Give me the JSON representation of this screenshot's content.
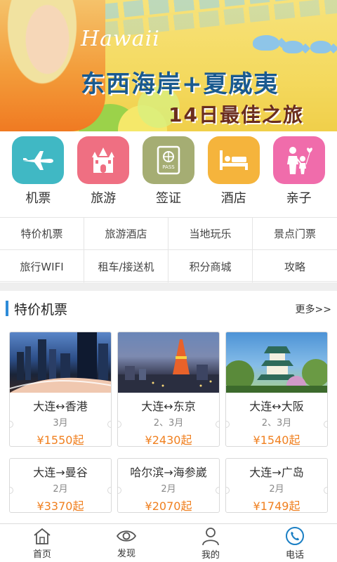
{
  "banner": {
    "script_text": "Hawaii",
    "headline": "东西海岸+夏威夷",
    "subline": "14日最佳之旅",
    "colors": {
      "bg": "#f4d95e",
      "headline": "#1a5a8f",
      "subline": "#6a2d1e"
    }
  },
  "categories": [
    {
      "label": "机票",
      "icon": "airplane-icon",
      "color": "#40b8c4"
    },
    {
      "label": "旅游",
      "icon": "castle-icon",
      "color": "#ef6f82"
    },
    {
      "label": "签证",
      "icon": "passport-icon",
      "color": "#a5ad73"
    },
    {
      "label": "酒店",
      "icon": "bed-icon",
      "color": "#f5b43c"
    },
    {
      "label": "亲子",
      "icon": "parent-child-icon",
      "color": "#f06cab"
    }
  ],
  "quick_links": [
    "特价机票",
    "旅游酒店",
    "当地玩乐",
    "景点门票",
    "旅行WIFI",
    "租车/接送机",
    "积分商城",
    "攻略"
  ],
  "section": {
    "title": "特价机票",
    "more": "更多>>",
    "accent": "#2d8bd8"
  },
  "flights": [
    {
      "route": "大连↔香港",
      "month": "3月",
      "price": "¥1550起",
      "price_value": "1550",
      "currency": "¥",
      "suffix": "起",
      "image": "city-night-skyline"
    },
    {
      "route": "大连↔东京",
      "month": "2、3月",
      "price": "¥2430起",
      "price_value": "2430",
      "currency": "¥",
      "suffix": "起",
      "image": "tokyo-tower-dusk"
    },
    {
      "route": "大连↔大阪",
      "month": "2、3月",
      "price": "¥1540起",
      "price_value": "1540",
      "currency": "¥",
      "suffix": "起",
      "image": "osaka-castle"
    },
    {
      "route": "大连→曼谷",
      "month": "2月",
      "price": "¥3370起",
      "price_value": "3370",
      "currency": "¥",
      "suffix": "起",
      "image": ""
    },
    {
      "route": "哈尔滨→海参崴",
      "month": "2月",
      "price": "¥2070起",
      "price_value": "2070",
      "currency": "¥",
      "suffix": "起",
      "image": ""
    },
    {
      "route": "大连→广岛",
      "month": "2月",
      "price": "¥1749起",
      "price_value": "1749",
      "currency": "¥",
      "suffix": "起",
      "image": ""
    }
  ],
  "price_color": "#f08020",
  "bottom_nav": [
    {
      "label": "首页",
      "icon": "home-icon"
    },
    {
      "label": "发现",
      "icon": "eye-icon"
    },
    {
      "label": "我的",
      "icon": "user-icon"
    },
    {
      "label": "电话",
      "icon": "phone-icon"
    }
  ]
}
